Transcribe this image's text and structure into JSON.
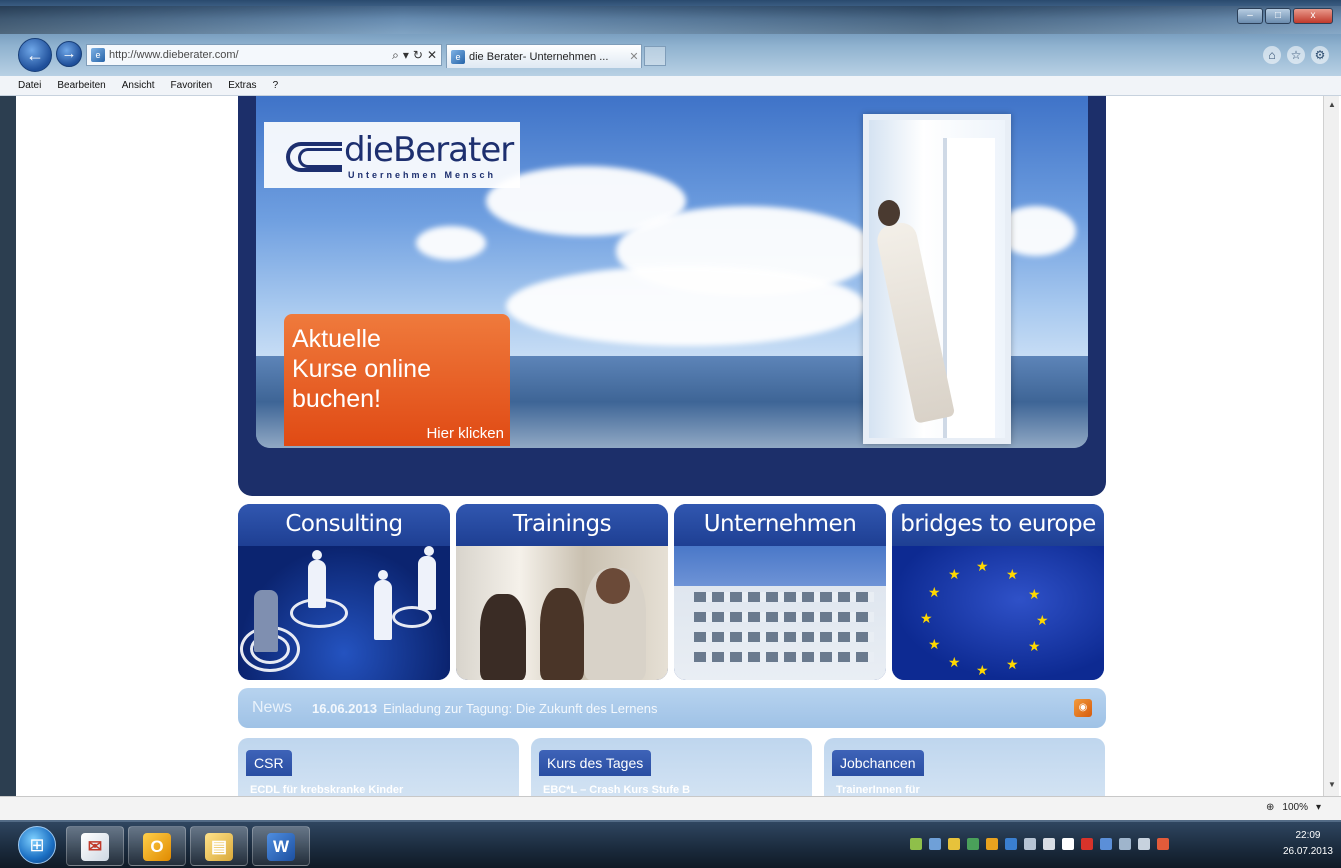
{
  "browser": {
    "url": "http://www.dieberater.com/",
    "tab_title": "die Berater- Unternehmen ...",
    "menu": [
      "Datei",
      "Bearbeiten",
      "Ansicht",
      "Favoriten",
      "Extras",
      "?"
    ],
    "zoom": "100%",
    "address_icons": [
      "search-icon",
      "refresh-icon",
      "stop-icon"
    ]
  },
  "site": {
    "logo": {
      "name": "dieBerater",
      "tagline": "Unternehmen Mensch"
    },
    "promo": {
      "line1": "Aktuelle",
      "line2": "Kurse online",
      "line3": "buchen!",
      "cta": "Hier klicken"
    },
    "tiles": [
      {
        "label": "Consulting"
      },
      {
        "label": "Trainings"
      },
      {
        "label": "Unternehmen"
      },
      {
        "label": "bridges to europe"
      }
    ],
    "news": {
      "label": "News",
      "date": "16.06.2013",
      "text": "Einladung zur Tagung: Die Zukunft des Lernens"
    },
    "boxes": [
      {
        "title": "CSR",
        "line": "ECDL für krebskranke Kinder"
      },
      {
        "title": "Kurs des Tages",
        "line": "EBC*L – Crash Kurs Stufe B"
      },
      {
        "title": "Jobchancen",
        "line": "TrainerInnen für"
      }
    ]
  },
  "taskbar": {
    "time": "22:09",
    "date": "26.07.2013",
    "apps": [
      "explorer",
      "outlook",
      "files",
      "word"
    ]
  }
}
